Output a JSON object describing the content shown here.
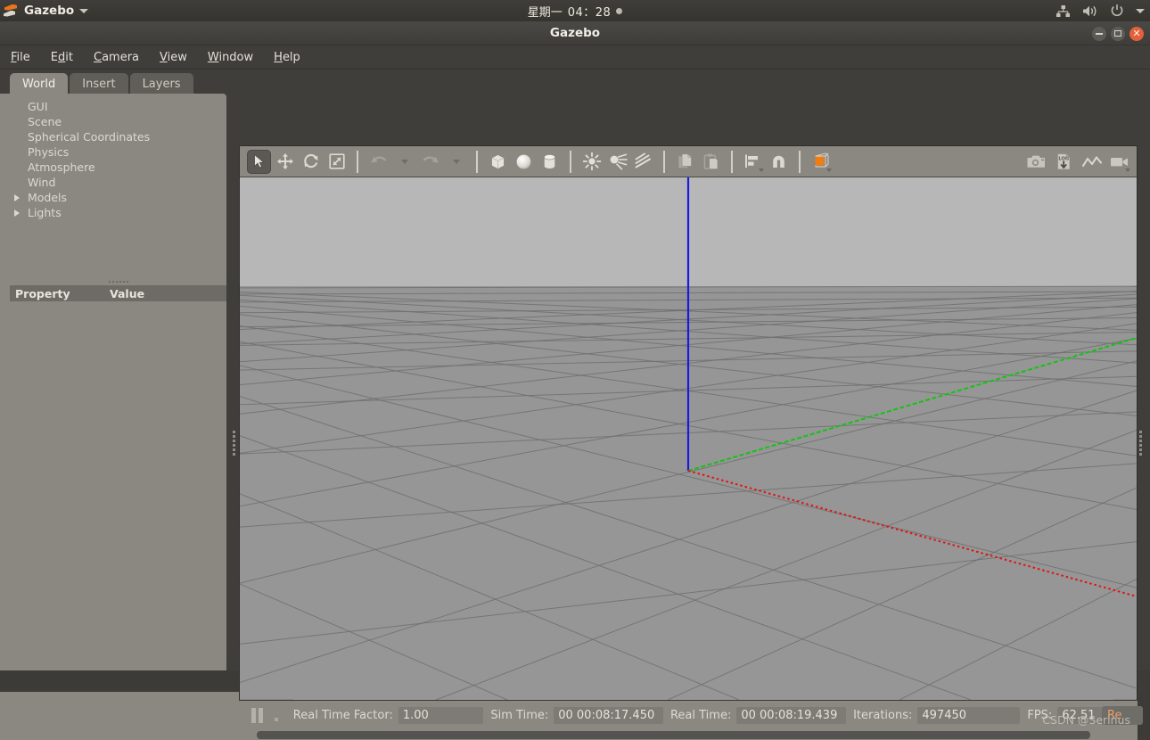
{
  "unity_panel": {
    "app_name": "Gazebo",
    "logo_icon": "gazebo-logo-icon",
    "app_menu_caret_icon": "chevron-down-icon",
    "clock_day": "星期一",
    "clock_time": "04：28",
    "clock_indicator_icon": "record-dot-icon",
    "tray": [
      {
        "icon": "network-icon"
      },
      {
        "icon": "volume-icon"
      },
      {
        "icon": "power-icon"
      },
      {
        "icon": "chevron-down-icon"
      }
    ]
  },
  "window": {
    "title": "Gazebo",
    "controls": [
      {
        "name": "minimize",
        "icon": "minimize-icon"
      },
      {
        "name": "maximize",
        "icon": "maximize-icon"
      },
      {
        "name": "close",
        "icon": "close-icon"
      }
    ],
    "close_color": "#e2613a"
  },
  "menubar": {
    "items": [
      {
        "label": "File",
        "accel": "F"
      },
      {
        "label": "Edit",
        "accel": "E"
      },
      {
        "label": "Camera",
        "accel": "C"
      },
      {
        "label": "View",
        "accel": "V"
      },
      {
        "label": "Window",
        "accel": "W"
      },
      {
        "label": "Help",
        "accel": "H"
      }
    ]
  },
  "left_panel": {
    "tabs": [
      {
        "label": "World",
        "active": true
      },
      {
        "label": "Insert",
        "active": false
      },
      {
        "label": "Layers",
        "active": false
      }
    ],
    "tree": [
      {
        "label": "GUI",
        "expandable": false
      },
      {
        "label": "Scene",
        "expandable": false
      },
      {
        "label": "Spherical Coordinates",
        "expandable": false
      },
      {
        "label": "Physics",
        "expandable": false
      },
      {
        "label": "Atmosphere",
        "expandable": false
      },
      {
        "label": "Wind",
        "expandable": false
      },
      {
        "label": "Models",
        "expandable": true
      },
      {
        "label": "Lights",
        "expandable": true
      }
    ],
    "property_table": {
      "columns": [
        "Property",
        "Value"
      ],
      "rows": []
    }
  },
  "toolbar": {
    "left_tools": [
      {
        "name": "select-mode",
        "icon": "arrow-cursor-icon",
        "active": true
      },
      {
        "name": "translate-mode",
        "icon": "move-arrows-icon",
        "active": false
      },
      {
        "name": "rotate-mode",
        "icon": "rotate-icon",
        "active": false
      },
      {
        "name": "scale-mode",
        "icon": "scale-icon",
        "active": false
      },
      {
        "name": "undo",
        "icon": "undo-arrow-icon",
        "active": false
      },
      {
        "name": "undo-history",
        "icon": "chevron-down-icon",
        "active": false
      },
      {
        "name": "redo",
        "icon": "redo-arrow-icon",
        "active": false
      },
      {
        "name": "redo-history",
        "icon": "chevron-down-icon",
        "active": false
      },
      {
        "name": "insert-box",
        "icon": "box-icon",
        "active": false
      },
      {
        "name": "insert-sphere",
        "icon": "sphere-icon",
        "active": false
      },
      {
        "name": "insert-cylinder",
        "icon": "cylinder-icon",
        "active": false
      },
      {
        "name": "point-light",
        "icon": "point-light-icon",
        "active": false
      },
      {
        "name": "spot-light",
        "icon": "spot-light-icon",
        "active": false
      },
      {
        "name": "directional-light",
        "icon": "directional-light-icon",
        "active": false
      },
      {
        "name": "copy",
        "icon": "copy-icon",
        "active": false
      },
      {
        "name": "paste",
        "icon": "paste-icon",
        "active": false
      },
      {
        "name": "align",
        "icon": "align-icon",
        "active": false
      },
      {
        "name": "snap",
        "icon": "magnet-snap-icon",
        "active": false
      },
      {
        "name": "change-view",
        "icon": "orange-cube-view-icon",
        "active": false
      }
    ],
    "right_tools": [
      {
        "name": "screenshot",
        "icon": "camera-icon"
      },
      {
        "name": "save-log",
        "icon": "log-download-icon",
        "label": "LOG"
      },
      {
        "name": "plot",
        "icon": "plot-line-icon"
      },
      {
        "name": "record-video",
        "icon": "video-camera-icon"
      }
    ]
  },
  "viewport": {
    "sky_color": "#b7b7b7",
    "ground_color": "#969696",
    "grid_color": "#6e6e6e",
    "axes": [
      {
        "name": "z-axis",
        "color": "#1414e6",
        "style": "solid"
      },
      {
        "name": "y-axis",
        "color": "#10c210",
        "style": "dashed"
      },
      {
        "name": "x-axis",
        "color": "#e01010",
        "style": "dotted"
      }
    ]
  },
  "statusbar": {
    "pause_button": "pause-icon",
    "step_button": "step-icon",
    "fields": [
      {
        "label": "Real Time Factor:",
        "value": "1.00",
        "name": "real-time-factor"
      },
      {
        "label": "Sim Time:",
        "value": "00 00:08:17.450",
        "name": "sim-time"
      },
      {
        "label": "Real Time:",
        "value": "00 00:08:19.439",
        "name": "real-time"
      },
      {
        "label": "Iterations:",
        "value": "497450",
        "name": "iterations"
      },
      {
        "label": "FPS:",
        "value": "62.51",
        "name": "fps"
      }
    ],
    "reset_button_label": "Re",
    "watermark": "CSDN @Serinus"
  }
}
